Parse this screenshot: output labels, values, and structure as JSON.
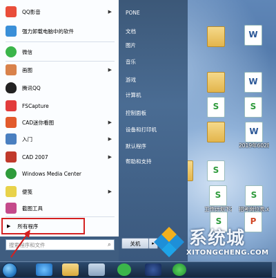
{
  "start_menu": {
    "left_items": [
      {
        "label": "QQ影音",
        "arrow": "▶",
        "icon": "qq-player-icon",
        "color": "#e94d3a"
      },
      {
        "label": "强力卸载电脑中的软件",
        "arrow": "",
        "icon": "uninstall-icon",
        "color": "#3a8fd8"
      },
      {
        "label": "微信",
        "arrow": "",
        "icon": "wechat-icon",
        "color": "#3bb54a"
      },
      {
        "label": "画图",
        "arrow": "▶",
        "icon": "paint-icon",
        "color": "#d9824b"
      },
      {
        "label": "腾讯QQ",
        "arrow": "",
        "icon": "qq-penguin-icon",
        "color": "#222222"
      },
      {
        "label": "FSCapture",
        "arrow": "",
        "icon": "fscapture-icon",
        "color": "#e23c3c"
      },
      {
        "label": "CAD迷你看图",
        "arrow": "▶",
        "icon": "cad-viewer-icon",
        "color": "#e25a2c"
      },
      {
        "label": "入门",
        "arrow": "▶",
        "icon": "getting-started-icon",
        "color": "#4a7fc0"
      },
      {
        "label": "CAD 2007",
        "arrow": "▶",
        "icon": "autocad-icon",
        "color": "#c0392b"
      },
      {
        "label": "Windows Media Center",
        "arrow": "",
        "icon": "media-center-icon",
        "color": "#2f9b3b"
      },
      {
        "label": "便笺",
        "arrow": "▶",
        "icon": "sticky-notes-icon",
        "color": "#e8d24a"
      },
      {
        "label": "截图工具",
        "arrow": "",
        "icon": "snipping-tool-icon",
        "color": "#c44a8b"
      }
    ],
    "all_programs": "所有程序",
    "search_placeholder": "搜索程序和文件",
    "right_links": [
      "PONE",
      "文档",
      "图片",
      "音乐",
      "游戏",
      "计算机",
      "控制面板",
      "设备和打印机",
      "默认程序",
      "帮助和支持"
    ],
    "shutdown_label": "关机"
  },
  "desktop": {
    "icons": [
      {
        "label": "",
        "type": "folder"
      },
      {
        "label": "",
        "type": "doc w"
      },
      {
        "label": "",
        "type": "folder"
      },
      {
        "label": "",
        "type": "doc w"
      },
      {
        "label": "",
        "type": "doc s"
      },
      {
        "label": "",
        "type": "doc s"
      },
      {
        "label": "",
        "type": "folder"
      },
      {
        "label": "2019年602B",
        "type": "doc w"
      },
      {
        "label": "",
        "type": "doc s"
      },
      {
        "label": "",
        "type": "folder"
      },
      {
        "label": "工作计划下发通知",
        "type": "doc s"
      },
      {
        "label": "招考岗位表.xls",
        "type": "doc s"
      },
      {
        "label": "",
        "type": "doc s"
      },
      {
        "label": "",
        "type": "doc p"
      }
    ]
  },
  "watermark": {
    "text_cn": "系统城",
    "text_en": "XITONGCHENG.COM"
  }
}
